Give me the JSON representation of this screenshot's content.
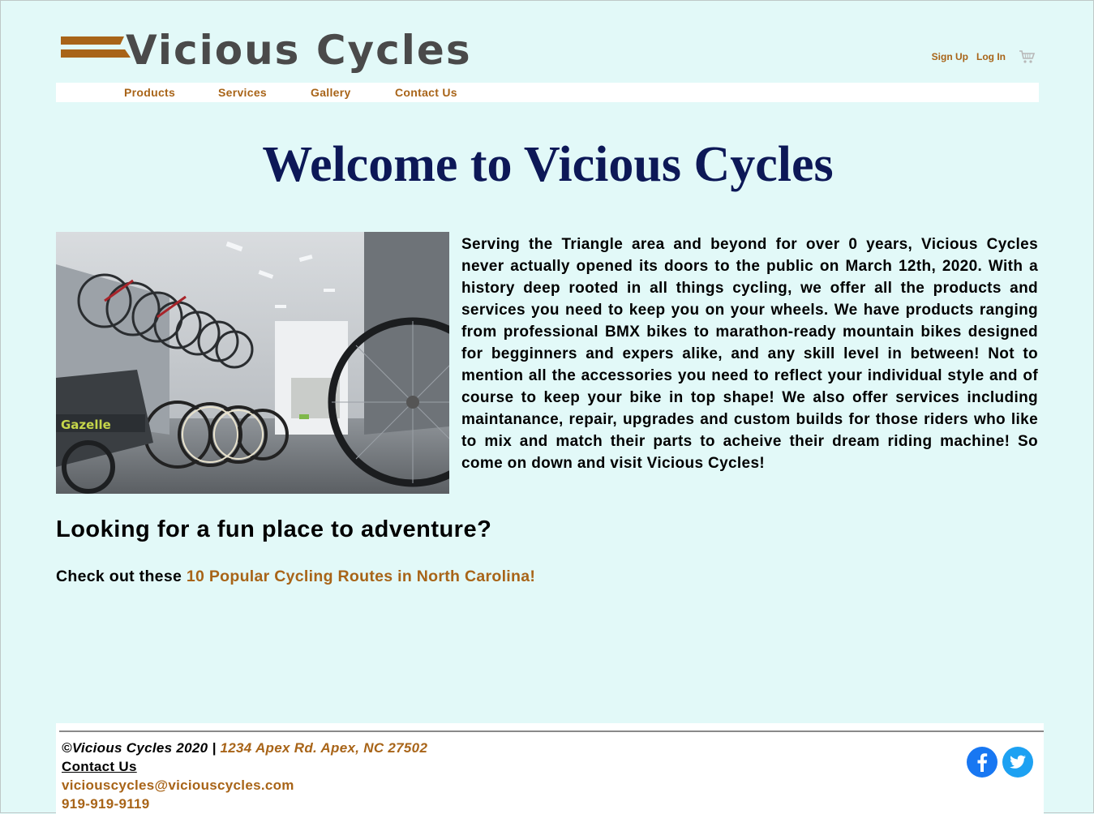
{
  "header": {
    "logo_text": "Vicious Cycles",
    "sign_up": "Sign Up",
    "log_in": "Log In",
    "cart_icon": "shopping-cart-icon"
  },
  "nav": {
    "items": [
      {
        "label": "Products"
      },
      {
        "label": "Services"
      },
      {
        "label": "Gallery"
      },
      {
        "label": "Contact Us"
      }
    ]
  },
  "main": {
    "title": "Welcome to Vicious Cycles",
    "intro": "Serving the Triangle area and beyond for over 0 years, Vicious Cycles never actually opened its doors to the public on March 12th, 2020. With a history deep rooted in all things cycling, we offer all the products and services you need to keep you on your wheels. We have products ranging from professional BMX bikes to marathon-ready mountain bikes designed for begginners and expers alike, and any skill level in between! Not to mention all the accessories you need to reflect your individual style and of course to keep your bike in top shape! We also offer services including maintanance, repair, upgrades and custom builds for those riders who like to mix and match their parts to acheive their dream riding machine! So come on down and visit Vicious Cycles!",
    "adventure_heading": "Looking for a fun place to adventure?",
    "routes_prefix": "Check out these ",
    "routes_link": "10 Popular Cycling Routes in North Carolina!",
    "photo_label": "Gazelle"
  },
  "footer": {
    "copyright": "©Vicious Cycles 2020 | ",
    "address": "1234 Apex Rd. Apex, NC 27502",
    "contact_label": "Contact Us",
    "email": "viciouscycles@viciouscycles.com",
    "phone": "919-919-9119",
    "social_icons": [
      "facebook-icon",
      "twitter-icon"
    ]
  },
  "colors": {
    "background": "#e2f9f8",
    "accent": "#a86418",
    "title": "#0d1857",
    "facebook": "#1877f2",
    "twitter": "#1da1f2"
  }
}
